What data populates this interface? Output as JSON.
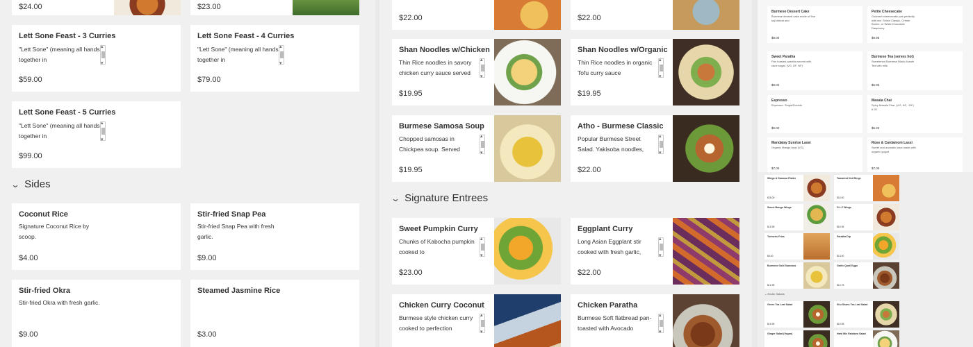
{
  "panel1": {
    "top_prices": [
      "$24.00",
      "$23.00"
    ],
    "feast_cards": [
      {
        "title": "Lett Sone Feast - 3 Curries",
        "desc": "\"Lett Sone\" (meaning all hands together in",
        "price": "$59.00"
      },
      {
        "title": "Lett Sone Feast - 4 Curries",
        "desc": "\"Lett Sone\" (meaning all hands together in",
        "price": "$79.00"
      },
      {
        "title": "Lett Sone Feast - 5 Curries",
        "desc": "\"Lett Sone\" (meaning all hands together in",
        "price": "$99.00"
      }
    ],
    "sides_label": "Sides",
    "sides": [
      {
        "title": "Coconut Rice",
        "desc": "Signature Coconut Rice by scoop.",
        "price": "$4.00"
      },
      {
        "title": "Stir-fried Snap Pea",
        "desc": "Stir-fried Snap Pea with fresh garlic.",
        "price": "$9.00"
      },
      {
        "title": "Stir-fried Okra",
        "desc": "Stir-fried Okra with fresh garlic.",
        "price": "$9.00"
      },
      {
        "title": "Steamed Jasmine Rice",
        "desc": "",
        "price": "$3.00"
      }
    ]
  },
  "panel2": {
    "top_prices": [
      "$22.00",
      "$22.00"
    ],
    "cards": [
      {
        "title": "Shan Noodles w/Chicken",
        "desc": "Thin Rice noodles in savory chicken curry sauce served",
        "price": "$19.95",
        "img": "noodle-photo"
      },
      {
        "title": "Shan Noodles w/Organic",
        "desc": "Thin Rice noodles in organic Tofu curry sauce",
        "price": "$19.95",
        "img": "noodle-tofu-photo"
      },
      {
        "title": "Burmese Samosa Soup",
        "desc": "Chopped samosas in Chickpea soup. Served",
        "price": "$19.95",
        "img": "soup-photo"
      },
      {
        "title": "Atho - Burmese Classic",
        "desc": "Popular Burmese Street Salad. Yakisoba noodles,",
        "price": "$22.00",
        "img": "salad-photo"
      }
    ],
    "section_label": "Signature Entrees",
    "entrees": [
      {
        "title": "Sweet Pumpkin Curry",
        "desc": "Chunks of Kabocha pumpkin cooked to",
        "price": "$23.00",
        "img": "pumpkin-photo"
      },
      {
        "title": "Eggplant Curry",
        "desc": "Long Asian Eggplant stir cooked with fresh garlic,",
        "price": "$22.00",
        "img": "eggplant-photo"
      },
      {
        "title": "Chicken Curry Coconut",
        "desc": "Burmese style chicken curry cooked to perfection",
        "price": "",
        "img": "chicken-photo"
      },
      {
        "title": "Chicken Paratha",
        "desc": "Burmese Soft flatbread pan-toasted with Avocado",
        "price": "",
        "img": "paratha-photo"
      }
    ]
  },
  "panel3": {
    "desserts": [
      {
        "title": "Burmese Dessert Cake",
        "desc": "Burmese dessert cake made of fine suji wheat and",
        "price": "$9.00"
      },
      {
        "title": "Petite Cheesecake",
        "desc": "Gourmet cheesecake pair perfectly with tea. Select Classic, Crème Brulee, or White Chocolate Raspberry",
        "price": "$9.95"
      },
      {
        "title": "Sweet Paratha",
        "desc": "Pan toasted paratha served with cane sugar. (VG, DF, NF)",
        "price": "$9.00"
      },
      {
        "title": "Burmese Tea (serves hot)",
        "desc": "Sweetened Burmese Black Assam Tea with milk.",
        "price": "$5.95"
      },
      {
        "title": "Espresso",
        "desc": "Espresso. Single/Double.",
        "price": "$0.00"
      },
      {
        "title": "Masala Chai",
        "desc": "Spicy Masala Chai. (VG, NF, ~DF) 6.25",
        "price": "$6.25"
      },
      {
        "title": "Mandalay Sunrise Lassi",
        "desc": "Organic Mango lassi (VG).",
        "price": "$7.00"
      },
      {
        "title": "Rose & Cardamom Lassi",
        "desc": "Sweet and aromatic lassi made with organic yogurt",
        "price": "$7.00"
      }
    ],
    "minis": [
      {
        "title": "Wings & Samosa Platter",
        "price": "$26.00"
      },
      {
        "title": "Tamarind Hot Wings",
        "price": "$16.00"
      },
      {
        "title": "Sweet Mango Wings",
        "price": "$15.95"
      },
      {
        "title": "G.L.F Wings",
        "price": "$15.95"
      },
      {
        "title": "Turmeric Fries",
        "price": "$9.00"
      },
      {
        "title": "Paratha Dip",
        "price": "$13.00"
      },
      {
        "title": "Burmese Gold Samosas",
        "price": "$12.95"
      },
      {
        "title": "Garlic Quail Eggs",
        "price": "$10.75"
      },
      {
        "title": "Green Tea Leaf Salad",
        "price": "$19.95"
      },
      {
        "title": "Shu Shanx Tea Leaf Salad",
        "price": "$19.95"
      },
      {
        "title": "Ginger Salad (Vegan)",
        "price": ""
      },
      {
        "title": "Hard Mix Rainbow Salad",
        "price": ""
      }
    ],
    "mini_section": "Exotic Salads"
  }
}
